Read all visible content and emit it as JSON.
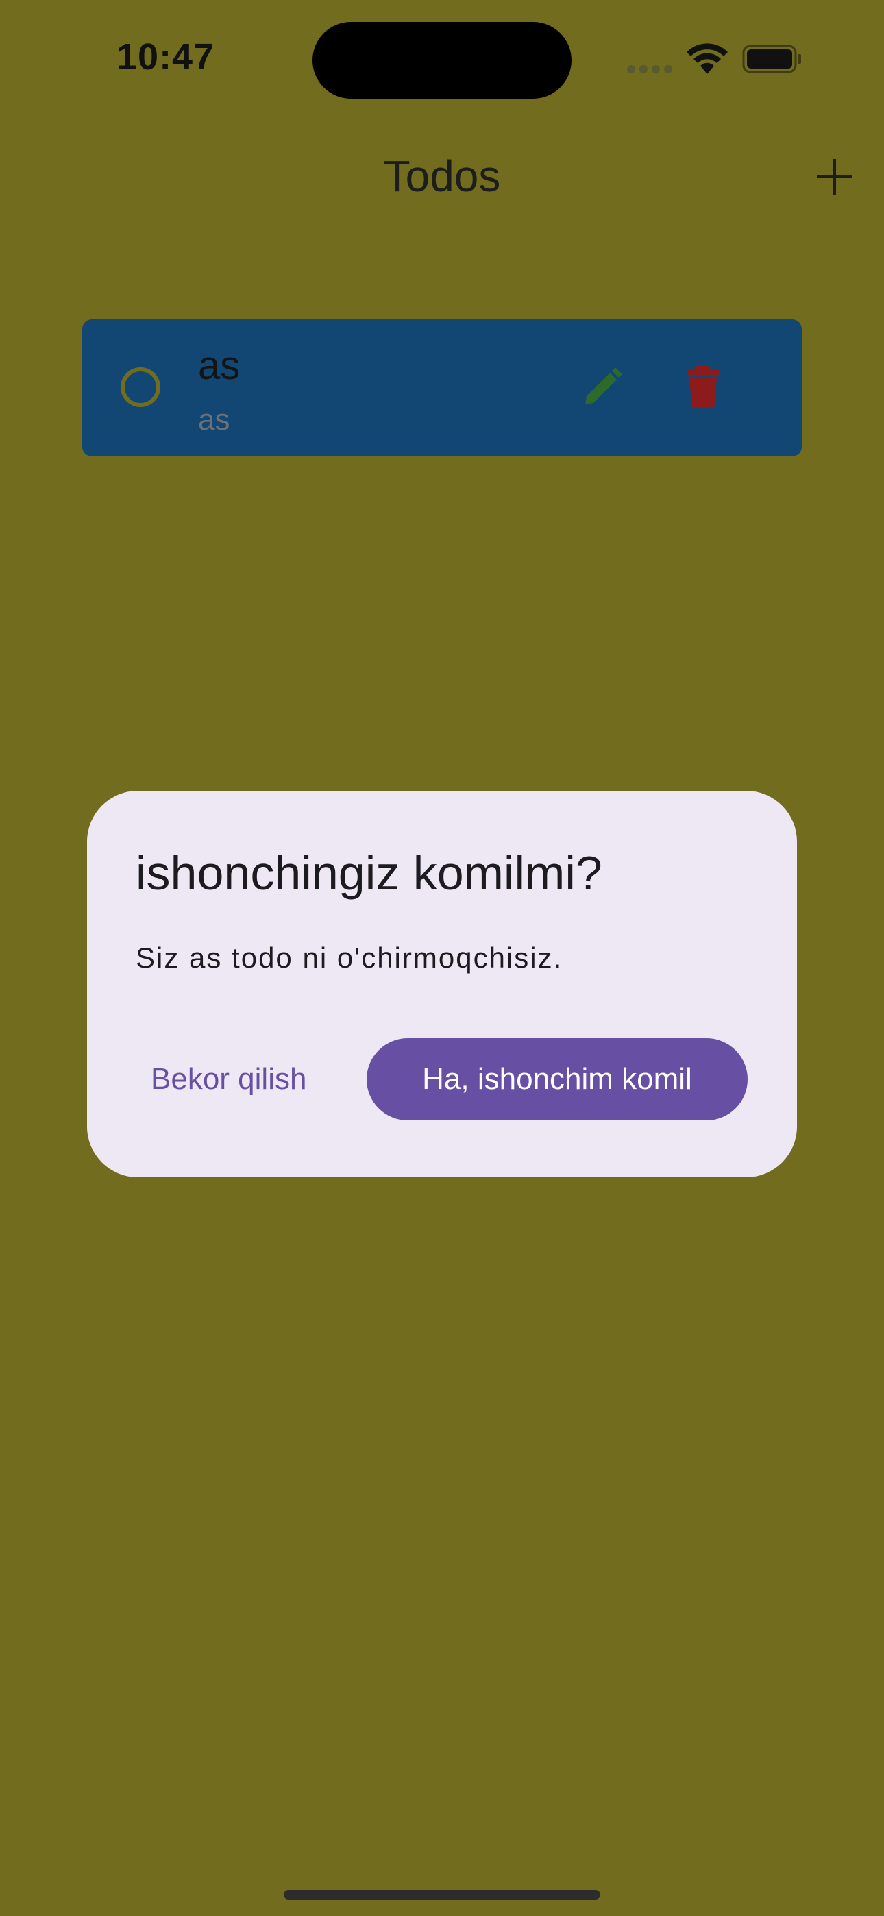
{
  "status_bar": {
    "time": "10:47"
  },
  "nav": {
    "title": "Todos",
    "add_icon": "plus-icon"
  },
  "todos": [
    {
      "title": "as",
      "subtitle": "as",
      "check_icon": "circle-outline-icon",
      "edit_icon": "pencil-icon",
      "delete_icon": "trash-icon"
    }
  ],
  "dialog": {
    "title": "ishonchingiz komilmi?",
    "message": "Siz as todo ni o'chirmoqchisiz.",
    "cancel_label": "Bekor qilish",
    "confirm_label": "Ha, ishonchim komil"
  },
  "colors": {
    "background": "#726C1E",
    "card": "#124774",
    "dialog": "#EEE8F4",
    "accent": "#6750A4",
    "edit": "#2E6B2A",
    "delete": "#8E1B1B"
  }
}
